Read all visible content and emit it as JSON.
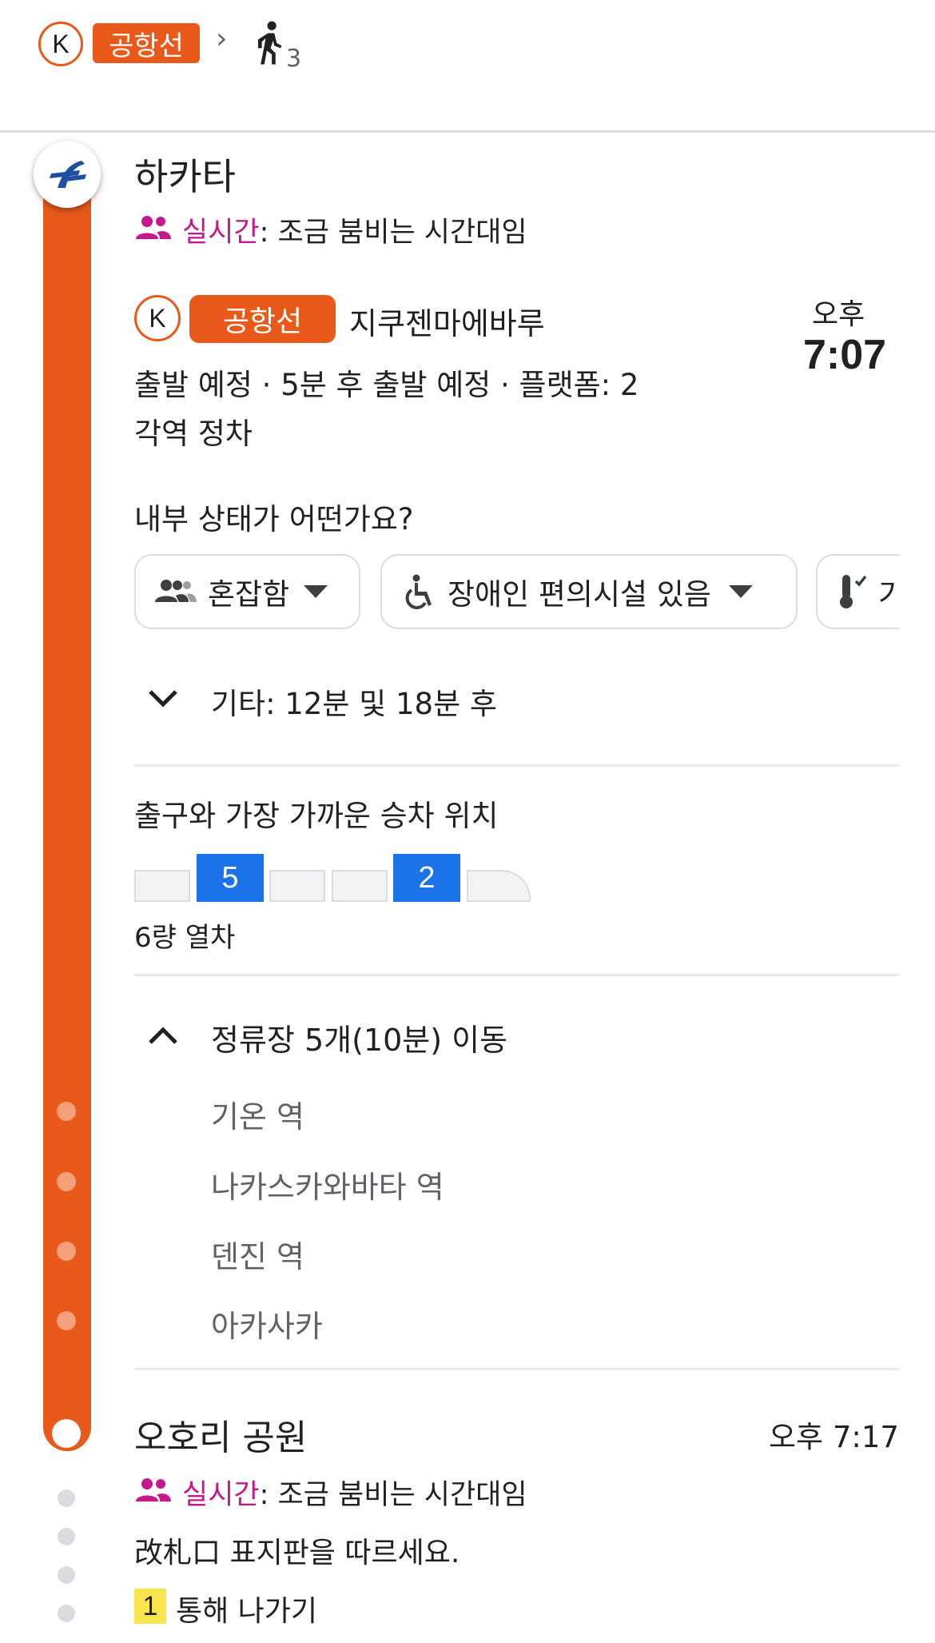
{
  "header": {
    "line_code": "K",
    "line_name": "공항선",
    "chevron": "›",
    "walk_minutes": "3"
  },
  "origin": {
    "station": "하카타",
    "crowd_label": "실시간",
    "crowd_text": ": 조금 붐비는 시간대임"
  },
  "departure": {
    "line_code": "K",
    "line_name": "공항선",
    "direction": "지쿠젠마에바루",
    "time_period": "오후",
    "time": "7:07",
    "status": "출발 예정 · 5분 후 출발 예정 · 플랫폼: 2",
    "service": "각역 정차"
  },
  "feedback": {
    "question": "내부 상태가 어떤가요?",
    "chips": [
      {
        "label": "혼잡함",
        "icon": "people-icon"
      },
      {
        "label": "장애인 편의시설 있음",
        "icon": "wheelchair-icon"
      },
      {
        "label": "기",
        "icon": "thermometer-icon"
      }
    ]
  },
  "more_departures": "기타: 12분 및 18분 후",
  "boarding": {
    "title": "출구와 가장 가까운 승차 위치",
    "car_labels": [
      "5",
      "2"
    ],
    "train_length": "6량 열차"
  },
  "stops": {
    "summary": "정류장 5개(10분) 이동",
    "list": [
      "기온 역",
      "나카스카와바타 역",
      "덴진 역",
      "아카사카"
    ]
  },
  "destination": {
    "station": "오호리 공원",
    "arrival": "오후 7:17",
    "crowd_label": "실시간",
    "crowd_text": ": 조금 붐비는 시간대임",
    "instruction": "改札口 표지판을 따르세요.",
    "exit_number": "1",
    "exit_text": "통해 나가기"
  },
  "colors": {
    "line": "#e8591a",
    "realtime": "#c5188c",
    "car_highlight": "#1a73e8",
    "exit_badge": "#f9e64f"
  }
}
